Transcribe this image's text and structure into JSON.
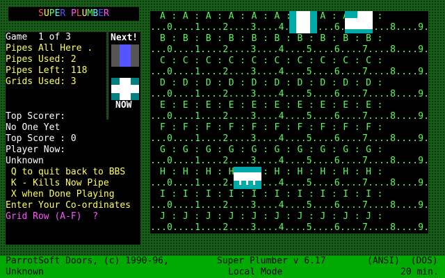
{
  "title_letters": [
    "S",
    "U",
    "P",
    "E",
    "R",
    " ",
    "P",
    "L",
    "U",
    "M",
    "B",
    "E",
    "R"
  ],
  "title_colors": [
    "#ff5555",
    "#ffff55",
    "#55ff55",
    "#55ffff",
    "#5555ff",
    "#000",
    "#ff55ff",
    "#ff5555",
    "#ffff55",
    "#55ff55",
    "#55ffff",
    "#5555ff",
    "#ff55ff"
  ],
  "info": {
    "game": "Game  1 of 3",
    "pipes_all": "Pipes All Here .",
    "pipes_used": "Pipes Used: 2",
    "pipes_left": "Pipes Left: 118",
    "grids_used": "Grids Used: 3"
  },
  "next_label": "Next!",
  "now_label": "NOW",
  "lower": {
    "top_scorer_label": "Top Scorer:",
    "top_scorer": "No One Yet",
    "top_score": "Top Score : 0",
    "player_now_label": "Player Now:",
    "player_now": "Unknown",
    "quit": " Q to quit back to BBS",
    "kill": " K - Kills Now Pipe",
    "done": " X when Done Playing",
    "enter": "Enter Your Co-ordinates",
    "prompt": "Grid Row (A-F)  ?"
  },
  "grid_rows": [
    {
      "letter_line": "A : A : A : A : A : A : A : A : A : A :",
      "number_line": "...0....1....2....3....4....5....6....7....8....9."
    },
    {
      "letter_line": "B : B : B : B : B : B : B : B : B : B :",
      "number_line": "...0....1....2....3....4....5....6....7....8....9."
    },
    {
      "letter_line": "C : C : C : C : C : C : C : C : C : C :",
      "number_line": "...0....1....2....3....4....5....6....7....8....9."
    },
    {
      "letter_line": "D : D : D : D : D : D : D : D : D : D :",
      "number_line": "...0....1....2....3....4....5....6....7....8....9."
    },
    {
      "letter_line": "E : E : E : E : E : E : E : E : E : E :",
      "number_line": "...0....1....2....3....4....5....6....7....8....9."
    },
    {
      "letter_line": "F : F : F : F : F : F : F : F : F : F :",
      "number_line": "...0....1....2....3....4....5....6....7....8....9."
    },
    {
      "letter_line": "G : G : G : G : G : G : G : G : G : G :",
      "number_line": "...0....1....2....3....4....5....6....7....8....9."
    },
    {
      "letter_line": "H : H : H : H : H : H : H : H : H : H :",
      "number_line": "...0....1....2....3....4....5....6....7....8....9."
    },
    {
      "letter_line": "I : I : I : I : I : I : I : I : I : I :",
      "number_line": "...0....1....2....3....4....5....6....7....8....9."
    },
    {
      "letter_line": "J : J : J : J : J : J : J : J : J : J :",
      "number_line": "...0....1....2....3....4....5....6....7....8....9."
    }
  ],
  "placed_pipes": [
    {
      "row": 0,
      "col": 5,
      "type": "vertical-pipe"
    },
    {
      "row": 0,
      "col": 7,
      "type": "elbow-pipe"
    },
    {
      "row": 7,
      "col": 3,
      "type": "horizontal-pipe"
    }
  ],
  "status": {
    "copyright": "ParrotSoft Doors, (c) 1990-96,",
    "version": "Super Plumber v 6.17",
    "term": "(ANSI)  (DOS)",
    "user": "Unknown",
    "mode": "Local Mode",
    "time": "20 min."
  },
  "colors": {
    "frame": "#1a5a1a",
    "grid_text": "#55ff55",
    "pipe_cyan": "#00aaaa",
    "pipe_white": "#ffffff",
    "next_pipe": "#5555ff",
    "status_bar": "#00aa00"
  }
}
